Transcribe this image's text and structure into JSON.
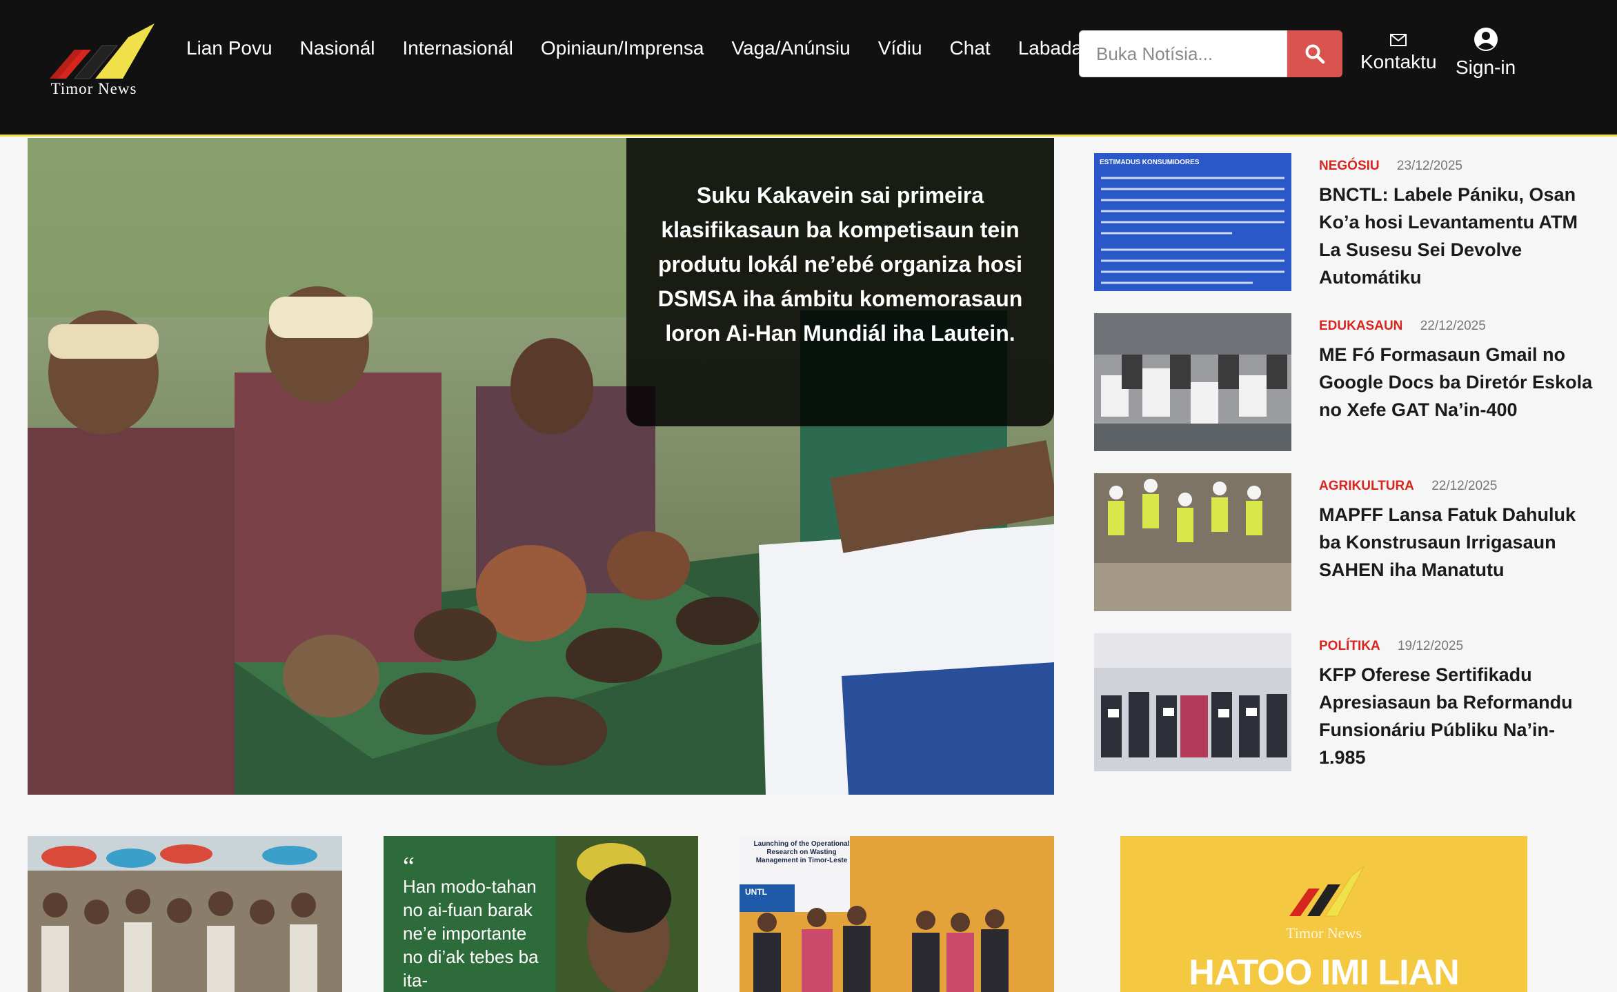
{
  "header": {
    "logo_text": "Timor News",
    "nav": [
      "Lian Povu",
      "Nasionál",
      "Internasionál",
      "Opiniaun/Imprensa",
      "Vaga/Anúnsiu",
      "Vídiu",
      "Chat",
      "Labadain"
    ],
    "search_placeholder": "Buka Notísia...",
    "contact_label": "Kontaktu",
    "signin_label": "Sign-in"
  },
  "hero": {
    "caption": "Suku Kakavein sai primeira klasifikasaun ba kompetisaun tein produtu lokál ne’ebé organiza hosi DSMSA iha ámbitu komemorasaun loron Ai-Han Mundiál iha Lautein."
  },
  "side_articles": [
    {
      "category": "NEGÓSIU",
      "date": "23/12/2025",
      "title": "BNCTL: Labele Pániku, Osan Ko’a hosi Levantamentu ATM La Susesu Sei Devolve Automátiku",
      "thumb_heading": "ESTIMADUS KONSUMIDORES"
    },
    {
      "category": "EDUKASAUN",
      "date": "22/12/2025",
      "title": "ME Fó Formasaun Gmail no Google Docs ba Diretór Eskola no Xefe GAT Na’in-400"
    },
    {
      "category": "AGRIKULTURA",
      "date": "22/12/2025",
      "title": "MAPFF Lansa Fatuk Dahuluk ba Konstrusaun Irrigasaun SAHEN iha Manatutu"
    },
    {
      "category": "POLÍTIKA",
      "date": "19/12/2025",
      "title": "KFP Oferese Sertifikadu Apresiasaun ba Reformandu Funsionáriu Públiku Na’in-1.985"
    }
  ],
  "cards": {
    "quote_text": "Han modo-tahan no ai-fuan barak ne’e importante no di’ak tebes ba ita-",
    "banner_text": "Launching of the Operational Research on Wasting Management in Timor-Leste",
    "banner_org": "UNTL"
  },
  "ad": {
    "logo_text": "Timor News",
    "headline": "HATOO IMI LIAN"
  },
  "colors": {
    "accent_red": "#d7261e",
    "search_btn": "#d9534f",
    "header_bg": "#111111",
    "header_border": "#f0e04a",
    "ad_bg": "#f5c842"
  }
}
